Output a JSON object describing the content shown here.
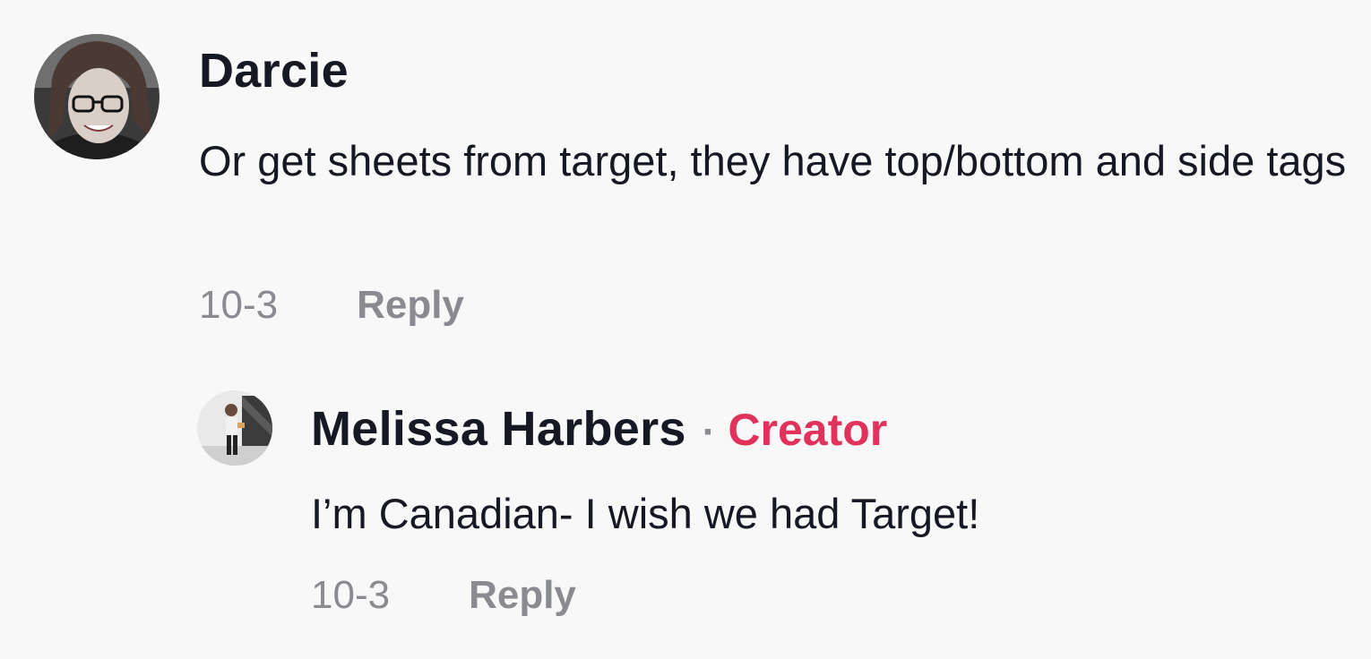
{
  "colors": {
    "background": "#f8f8f8",
    "text_primary": "#161823",
    "text_secondary": "#8a8b91",
    "creator_accent": "#e0325a"
  },
  "comments": [
    {
      "username": "Darcie",
      "text": "Or get sheets from target, they have top/bottom and side tags",
      "date": "10-3",
      "reply_label": "Reply",
      "avatar_icon": "user-avatar-photo"
    }
  ],
  "replies": [
    {
      "username": "Melissa Harbers",
      "separator": "·",
      "badge": "Creator",
      "text": "I’m Canadian- I wish we had Target!",
      "date": "10-3",
      "reply_label": "Reply",
      "avatar_icon": "creator-avatar-photo"
    }
  ]
}
